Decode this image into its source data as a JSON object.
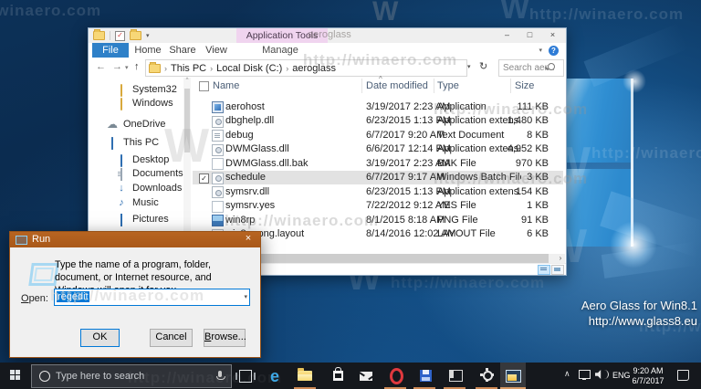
{
  "icons": {
    "chevron_right": "›",
    "chevron_left": "‹",
    "dropdown": "▾",
    "sort_asc": "^",
    "back": "←",
    "forward": "→",
    "up": "↑",
    "refresh": "↻",
    "minimize": "–",
    "maximize": "□",
    "close": "×",
    "check": "✓",
    "help": "?",
    "music_note": "♪",
    "down_arrow": "↓",
    "cloud": "☁",
    "tray_up": "∧"
  },
  "watermarks": {
    "url": "http://winaero.com",
    "w": "W"
  },
  "desktop": {
    "credit_line1": "Aero Glass for Win8.1",
    "credit_line2": "http://www.glass8.eu"
  },
  "explorer": {
    "app_tools_label": "Application Tools",
    "window_title": "aeroglass",
    "tabs": {
      "file": "File",
      "home": "Home",
      "share": "Share",
      "view": "View",
      "manage": "Manage"
    },
    "breadcrumb": [
      "This PC",
      "Local Disk (C:)",
      "aeroglass"
    ],
    "search_placeholder": "Search aer...",
    "columns": [
      "Name",
      "Date modified",
      "Type",
      "Size"
    ],
    "sidebar": [
      {
        "label": "System32",
        "icon": "folder"
      },
      {
        "label": "Windows",
        "icon": "folder"
      },
      {
        "label": "OneDrive",
        "icon": "cloud"
      },
      {
        "label": "This PC",
        "icon": "pc"
      },
      {
        "label": "Desktop",
        "icon": "desktop"
      },
      {
        "label": "Documents",
        "icon": "documents"
      },
      {
        "label": "Downloads",
        "icon": "downloads"
      },
      {
        "label": "Music",
        "icon": "music"
      },
      {
        "label": "Pictures",
        "icon": "pictures"
      }
    ],
    "files": [
      {
        "name": "aerohost",
        "date": "3/19/2017 2:23 AM",
        "type": "Application",
        "size": "111 KB",
        "icon": "application",
        "selected": false
      },
      {
        "name": "dbghelp.dll",
        "date": "6/23/2015 1:13 PM",
        "type": "Application extens...",
        "size": "1,480 KB",
        "icon": "dll",
        "selected": false
      },
      {
        "name": "debug",
        "date": "6/7/2017 9:20 AM",
        "type": "Text Document",
        "size": "8 KB",
        "icon": "text",
        "selected": false
      },
      {
        "name": "DWMGlass.dll",
        "date": "6/6/2017 12:14 PM",
        "type": "Application extens...",
        "size": "4,952 KB",
        "icon": "dll",
        "selected": false
      },
      {
        "name": "DWMGlass.dll.bak",
        "date": "3/19/2017 2:23 AM",
        "type": "BAK File",
        "size": "970 KB",
        "icon": "file",
        "selected": false
      },
      {
        "name": "schedule",
        "date": "6/7/2017 9:17 AM",
        "type": "Windows Batch File",
        "size": "3 KB",
        "icon": "batch",
        "selected": true
      },
      {
        "name": "symsrv.dll",
        "date": "6/23/2015 1:13 PM",
        "type": "Application extens...",
        "size": "154 KB",
        "icon": "dll",
        "selected": false
      },
      {
        "name": "symsrv.yes",
        "date": "7/22/2012 9:12 AM",
        "type": "YES File",
        "size": "1 KB",
        "icon": "file",
        "selected": false
      },
      {
        "name": "win8rp",
        "date": "8/1/2015 8:18 AM",
        "type": "PNG File",
        "size": "91 KB",
        "icon": "png",
        "selected": false
      },
      {
        "name": "win8rp.png.layout",
        "date": "8/14/2016 12:02 AM",
        "type": "LAYOUT File",
        "size": "6 KB",
        "icon": "file",
        "selected": false
      }
    ]
  },
  "run_dialog": {
    "title": "Run",
    "message": "Type the name of a program, folder, document, or Internet resource, and Windows will open it for you.",
    "open_key": "O",
    "open_rest": "pen:",
    "value": "regedit",
    "ok": "OK",
    "cancel": "Cancel",
    "browse_key": "B",
    "browse_rest": "rowse..."
  },
  "taskbar": {
    "search_placeholder": "Type here to search",
    "tray": {
      "language": "ENG",
      "time": "9:20 AM",
      "date": "6/7/2017"
    }
  }
}
